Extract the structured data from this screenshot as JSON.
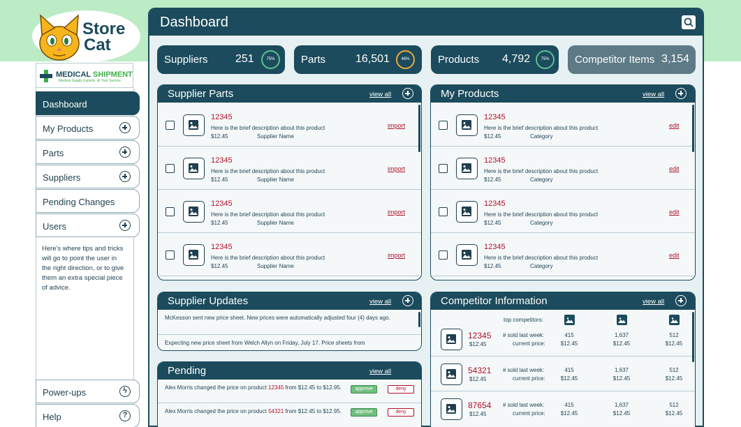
{
  "brand": {
    "name_line1": "Store",
    "name_line2": "Cat"
  },
  "partner": {
    "name_part1": "MEDICAL",
    "name_part2": "SHIPMENT",
    "tagline": "Medical Supply Experts. At Your Service"
  },
  "nav": {
    "items": [
      {
        "label": "Dashboard"
      },
      {
        "label": "My Products"
      },
      {
        "label": "Parts"
      },
      {
        "label": "Suppliers"
      },
      {
        "label": "Pending Changes"
      },
      {
        "label": "Users"
      }
    ],
    "tips": "Here's where tips and tricks will go to point the user in the right direction, or to give them an extra special piece of advice.",
    "bottom": [
      {
        "label": "Power-ups"
      },
      {
        "label": "Help"
      }
    ]
  },
  "header": {
    "title": "Dashboard"
  },
  "stats": [
    {
      "label": "Suppliers",
      "value": "251",
      "pct": "75%"
    },
    {
      "label": "Parts",
      "value": "16,501",
      "pct": "46%"
    },
    {
      "label": "Products",
      "value": "4,792",
      "pct": "75%"
    },
    {
      "label": "Competitor Items",
      "value": "3,154"
    }
  ],
  "supplier_parts": {
    "title": "Supplier Parts",
    "view_all": "view all",
    "rows": [
      {
        "id": "12345",
        "desc": "Here is the brief description about this product",
        "price": "$12.45",
        "sub": "Supplier Name",
        "action": "import"
      },
      {
        "id": "12345",
        "desc": "Here is the brief description about this product",
        "price": "$12.45",
        "sub": "Supplier Name",
        "action": "import"
      },
      {
        "id": "12345",
        "desc": "Here is the brief description about this product",
        "price": "$12.45",
        "sub": "Supplier Name",
        "action": "import"
      },
      {
        "id": "12345",
        "desc": "Here is the brief description about this product",
        "price": "$12.45",
        "sub": "Supplier Name",
        "action": "import"
      }
    ]
  },
  "my_products": {
    "title": "My Products",
    "view_all": "view all",
    "rows": [
      {
        "id": "12345",
        "desc": "Here is the brief description about this product",
        "price": "$12.45",
        "sub": "Category",
        "action": "edit"
      },
      {
        "id": "12345",
        "desc": "Here is the brief description about this product",
        "price": "$12.45",
        "sub": "Category",
        "action": "edit"
      },
      {
        "id": "12345",
        "desc": "Here is the brief description about this product",
        "price": "$12.45",
        "sub": "Category",
        "action": "edit"
      },
      {
        "id": "12345",
        "desc": "Here is the brief description about this product",
        "price": "$12.45",
        "sub": "Category",
        "action": "edit"
      }
    ]
  },
  "supplier_updates": {
    "title": "Supplier Updates",
    "view_all": "view all",
    "items": [
      {
        "text": "McKesson sent new price sheet. New prices were automatically adjusted four (4) days ago."
      },
      {
        "text": "Expecting new price sheet from Welch Allyn on Friday, July 17. Price sheets from"
      }
    ]
  },
  "pending": {
    "title": "Pending",
    "view_all": "view all",
    "items": [
      {
        "pre": "Alex Morris changed the price on product ",
        "product": "12345",
        "post": " from $12.45 to $12.95.",
        "approve": "approve",
        "deny": "deny"
      },
      {
        "pre": "Alex Morris changed the price on product ",
        "product": "54321",
        "post": " from $12.45 to $12.95.",
        "approve": "approve",
        "deny": "deny"
      }
    ]
  },
  "competitor": {
    "title": "Competitor Information",
    "view_all": "view all",
    "top_label": "top competitors:",
    "sold_label": "# sold last week:",
    "price_label": "current price:",
    "rows": [
      {
        "id": "87654",
        "price": "$12.45",
        "sold": [
          "415",
          "1,637",
          "512"
        ],
        "prices": [
          "$12.45",
          "$12.45",
          "$12.45"
        ]
      }
    ]
  }
}
